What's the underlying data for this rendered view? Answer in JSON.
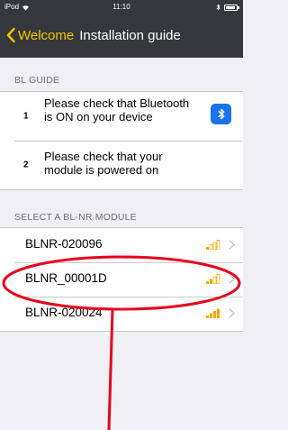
{
  "status_bar": {
    "carrier": "iPod",
    "time": "11:10"
  },
  "nav": {
    "back_label": "Welcome",
    "title": "Installation guide",
    "accent_color": "#f5c800",
    "bar_color": "#35373a"
  },
  "guide": {
    "header": "BL GUIDE",
    "steps": [
      {
        "number": "1",
        "text": "Please check that Bluetooth is ON on your device"
      },
      {
        "number": "2",
        "text": "Please check that your module is powered on"
      }
    ]
  },
  "modules": {
    "header": "SELECT A BL-NR MODULE",
    "items": [
      {
        "name": "BLNR-020096",
        "signal_bars": 1
      },
      {
        "name": "BLNR_00001D",
        "signal_bars": 2
      },
      {
        "name": "BLNR-020024",
        "signal_bars": 4
      }
    ]
  },
  "annotation": {
    "color": "#e8001c"
  },
  "icons": {
    "bluetooth": "bluetooth-icon",
    "wifi": "wifi-icon",
    "battery": "battery-icon",
    "back": "chevron-left-icon",
    "disclosure": "chevron-right-icon"
  }
}
